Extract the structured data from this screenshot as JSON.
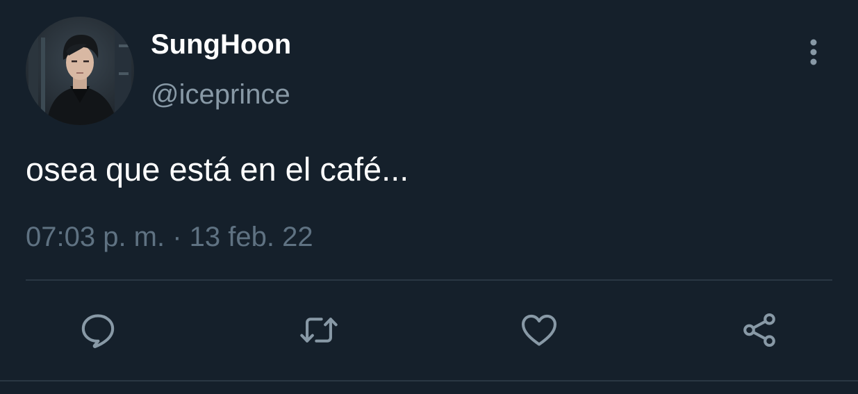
{
  "tweet": {
    "author": {
      "display_name": "SungHoon",
      "handle": "@iceprince",
      "avatar_icon": "profile-photo"
    },
    "text": "osea que está en el café...",
    "timestamp": "07:03 p. m. · 13 feb. 22",
    "more_icon": "vertical-ellipsis-icon",
    "actions": [
      {
        "name": "reply",
        "icon": "speech-bubble-icon"
      },
      {
        "name": "retweet",
        "icon": "retweet-arrows-icon"
      },
      {
        "name": "like",
        "icon": "heart-outline-icon"
      },
      {
        "name": "share",
        "icon": "share-nodes-icon"
      }
    ]
  },
  "colors": {
    "background": "#15202b",
    "primary_text": "#ffffff",
    "secondary_text": "#8899a6",
    "icon": "#8899a6",
    "divider": "#2a3743"
  }
}
